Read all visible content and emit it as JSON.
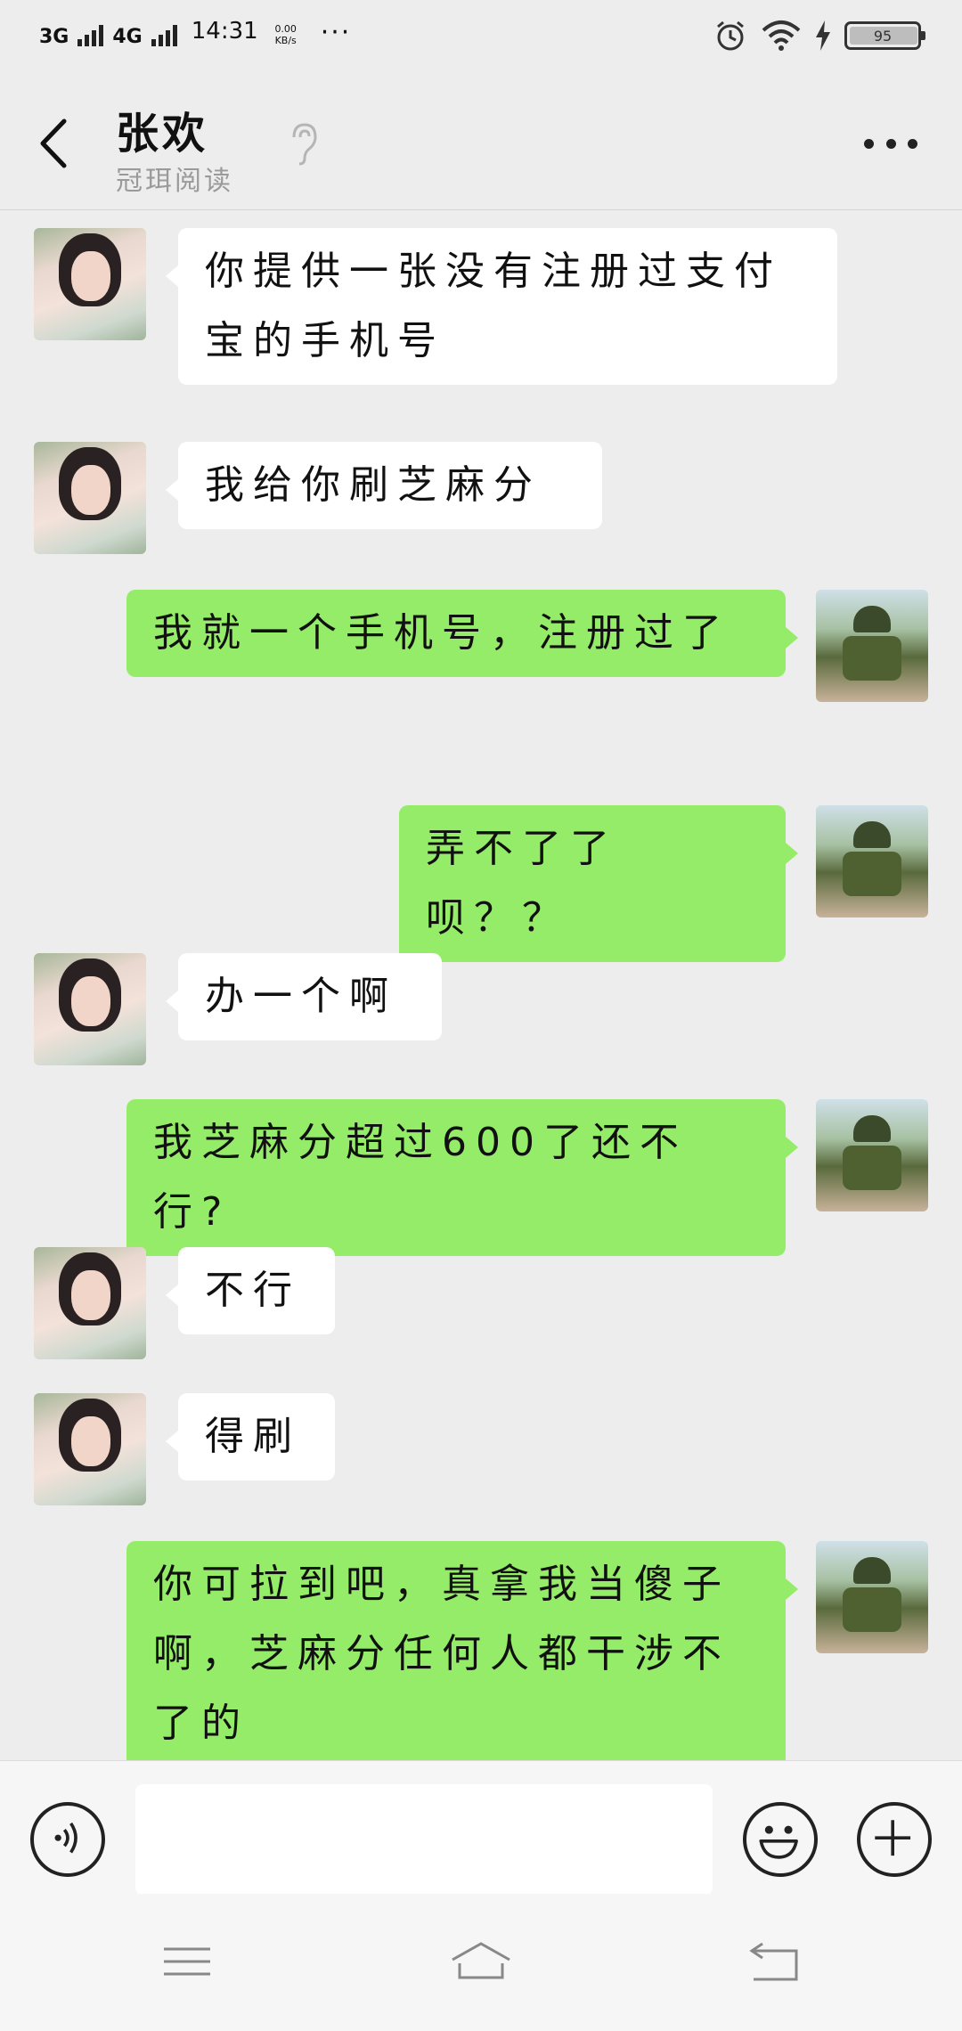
{
  "status_bar": {
    "network_1": "3G",
    "network_2": "4G",
    "time": "14:31",
    "speed_value": "0.00",
    "speed_unit": "KB/s",
    "more": "···",
    "battery": "95",
    "icons": [
      "alarm-icon",
      "wifi-icon",
      "charging-icon",
      "battery-icon"
    ]
  },
  "header": {
    "title": "张欢",
    "subtitle": "冠珥阅读",
    "icons": [
      "back-icon",
      "ear-icon",
      "more-icon"
    ]
  },
  "messages": [
    {
      "side": "in",
      "text": "你提供一张没有注册过支付宝的手机号"
    },
    {
      "side": "in",
      "text": "我给你刷芝麻分"
    },
    {
      "side": "out",
      "text": "我就一个手机号，注册过了"
    },
    {
      "side": "out",
      "text": "弄不了了呗？？"
    },
    {
      "side": "in",
      "text": "办一个啊"
    },
    {
      "side": "out",
      "text": "我芝麻分超过600了还不行?"
    },
    {
      "side": "in",
      "text": "不行"
    },
    {
      "side": "in",
      "text": "得刷"
    },
    {
      "side": "out",
      "text": "你可拉到吧，真拿我当傻子啊，芝麻分任何人都干涉不了的"
    }
  ],
  "input_bar": {
    "text_value": "",
    "icons": [
      "voice-icon",
      "emoji-icon",
      "plus-icon"
    ]
  },
  "nav_bar": {
    "icons": [
      "menu-icon",
      "home-icon",
      "back-nav-icon"
    ]
  }
}
